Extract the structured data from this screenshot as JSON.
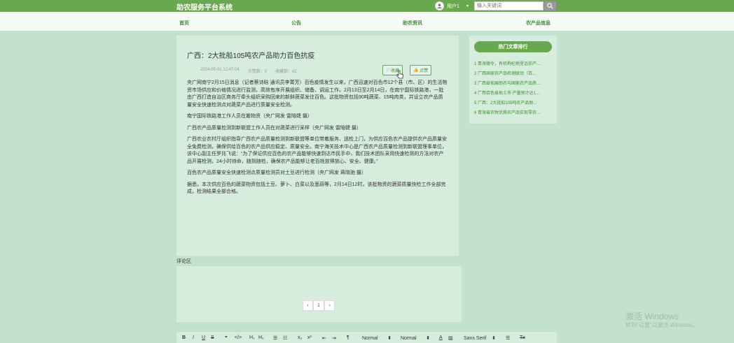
{
  "header": {
    "brand": "助农服务平台系统",
    "user_name": "用户1",
    "search_placeholder": "输入关键词"
  },
  "nav": {
    "items": [
      "首页",
      "公告",
      "助农资讯",
      "农产品信息"
    ]
  },
  "article": {
    "title": "广西：2大批船105吨农产品助力百色抗疫",
    "date": "2024-05-01 12:47:04",
    "likes": "点赞数：0",
    "collects": "收藏数：62",
    "collect_label": "收藏",
    "like_label": "点赞",
    "paragraphs": [
      "央广网南宁2月15日消息（记者蔡诗晗 通讯员李菁芳）百色疫情发生以来，广西迅速对百色市12个县（市、区）的生活物资市场供应和价格情况进行监测，高效有序开展组织、储备、调运工作。2月13日至2月14日，在南宁国际铁路港，一批由广西打造自治区商务厅牵头组织采购回来的新鲜蔬菜发往百色。这批物资包括90吨蔬菜、15吨肉类，并设立农产品质量安全快速检测点对蔬菜产品进行质量安全检测。",
      "南宁国际铁路港工作人员在搬物资（央广网发 雷陪婕 摄）",
      "广西农产品质量检测到新联盟工作人员在对蔬菜进行采样（央广网发 雷陪婕 摄）",
      "广西农业农村厅组织指导广西农产品质量检测到新联盟等单位带着服务、送检上门，为供应百色农产品提供农产品质量安全免费检测，确保供给百色的农产品供应稳定、质量安全。南宁海关技术中心是广西农产品质量检测到新联盟理事单位，该中心副主任罗兆飞说：“为了保证供应百色的农产品能够快速到达市民手中，我们技术团队采用快速检测的方法对农产品开展检测，24小时待命，随到随检，确保农产品能够让老百姓放得放心、安全、健康。”",
      "百色农产品质量安全快速检测点质量检测员对土豆进行检测（央广网发 蒋晓驰 摄）",
      "据悉，本次供应百色的蔬菜物资包括土豆、萝卜、白菜以及葱蒜等，2月14日12时，该批物资的蔬菜质量快检工作全部完成，检测结果全部合格。"
    ]
  },
  "sidebar": {
    "title": "热门文章排行",
    "items": [
      "1  青海德令，有机枸杞地里话农产...",
      "2  广西国家农产品检测联动（百...",
      "3  广西省拓展助农与国家农产品质...",
      "4  广西百色县佑土市 产量预计达1...",
      "5  广西：2大批船105吨农产品助...",
      "6  青海省农牧优质农产品实现零农..."
    ]
  },
  "comments": {
    "label": "评论区",
    "pager": [
      "‹",
      "1",
      "›"
    ]
  },
  "watermark": {
    "line1": "激活 Windows",
    "line2": "转到\"设置\"以激活 Windows。"
  },
  "editor": {
    "bold": "B",
    "italic": "I",
    "underline": "U",
    "strike": "S",
    "quote": "❞",
    "code": "</>",
    "h1": "H₁",
    "h2": "H₂",
    "ol": "☰",
    "ul": "☷",
    "sub": "x₂",
    "sup": "x²",
    "indent_l": "⇤",
    "indent_r": "⇥",
    "rtl": "¶",
    "size1": "Normal",
    "size2": "Normal",
    "color": "A",
    "bg": "▨",
    "font": "Sans Serif",
    "align": "☰",
    "clean": "Tx"
  },
  "colors": {
    "accent": "#6aa84f",
    "background": "#c3e2cd",
    "card": "#d6ecdd"
  }
}
